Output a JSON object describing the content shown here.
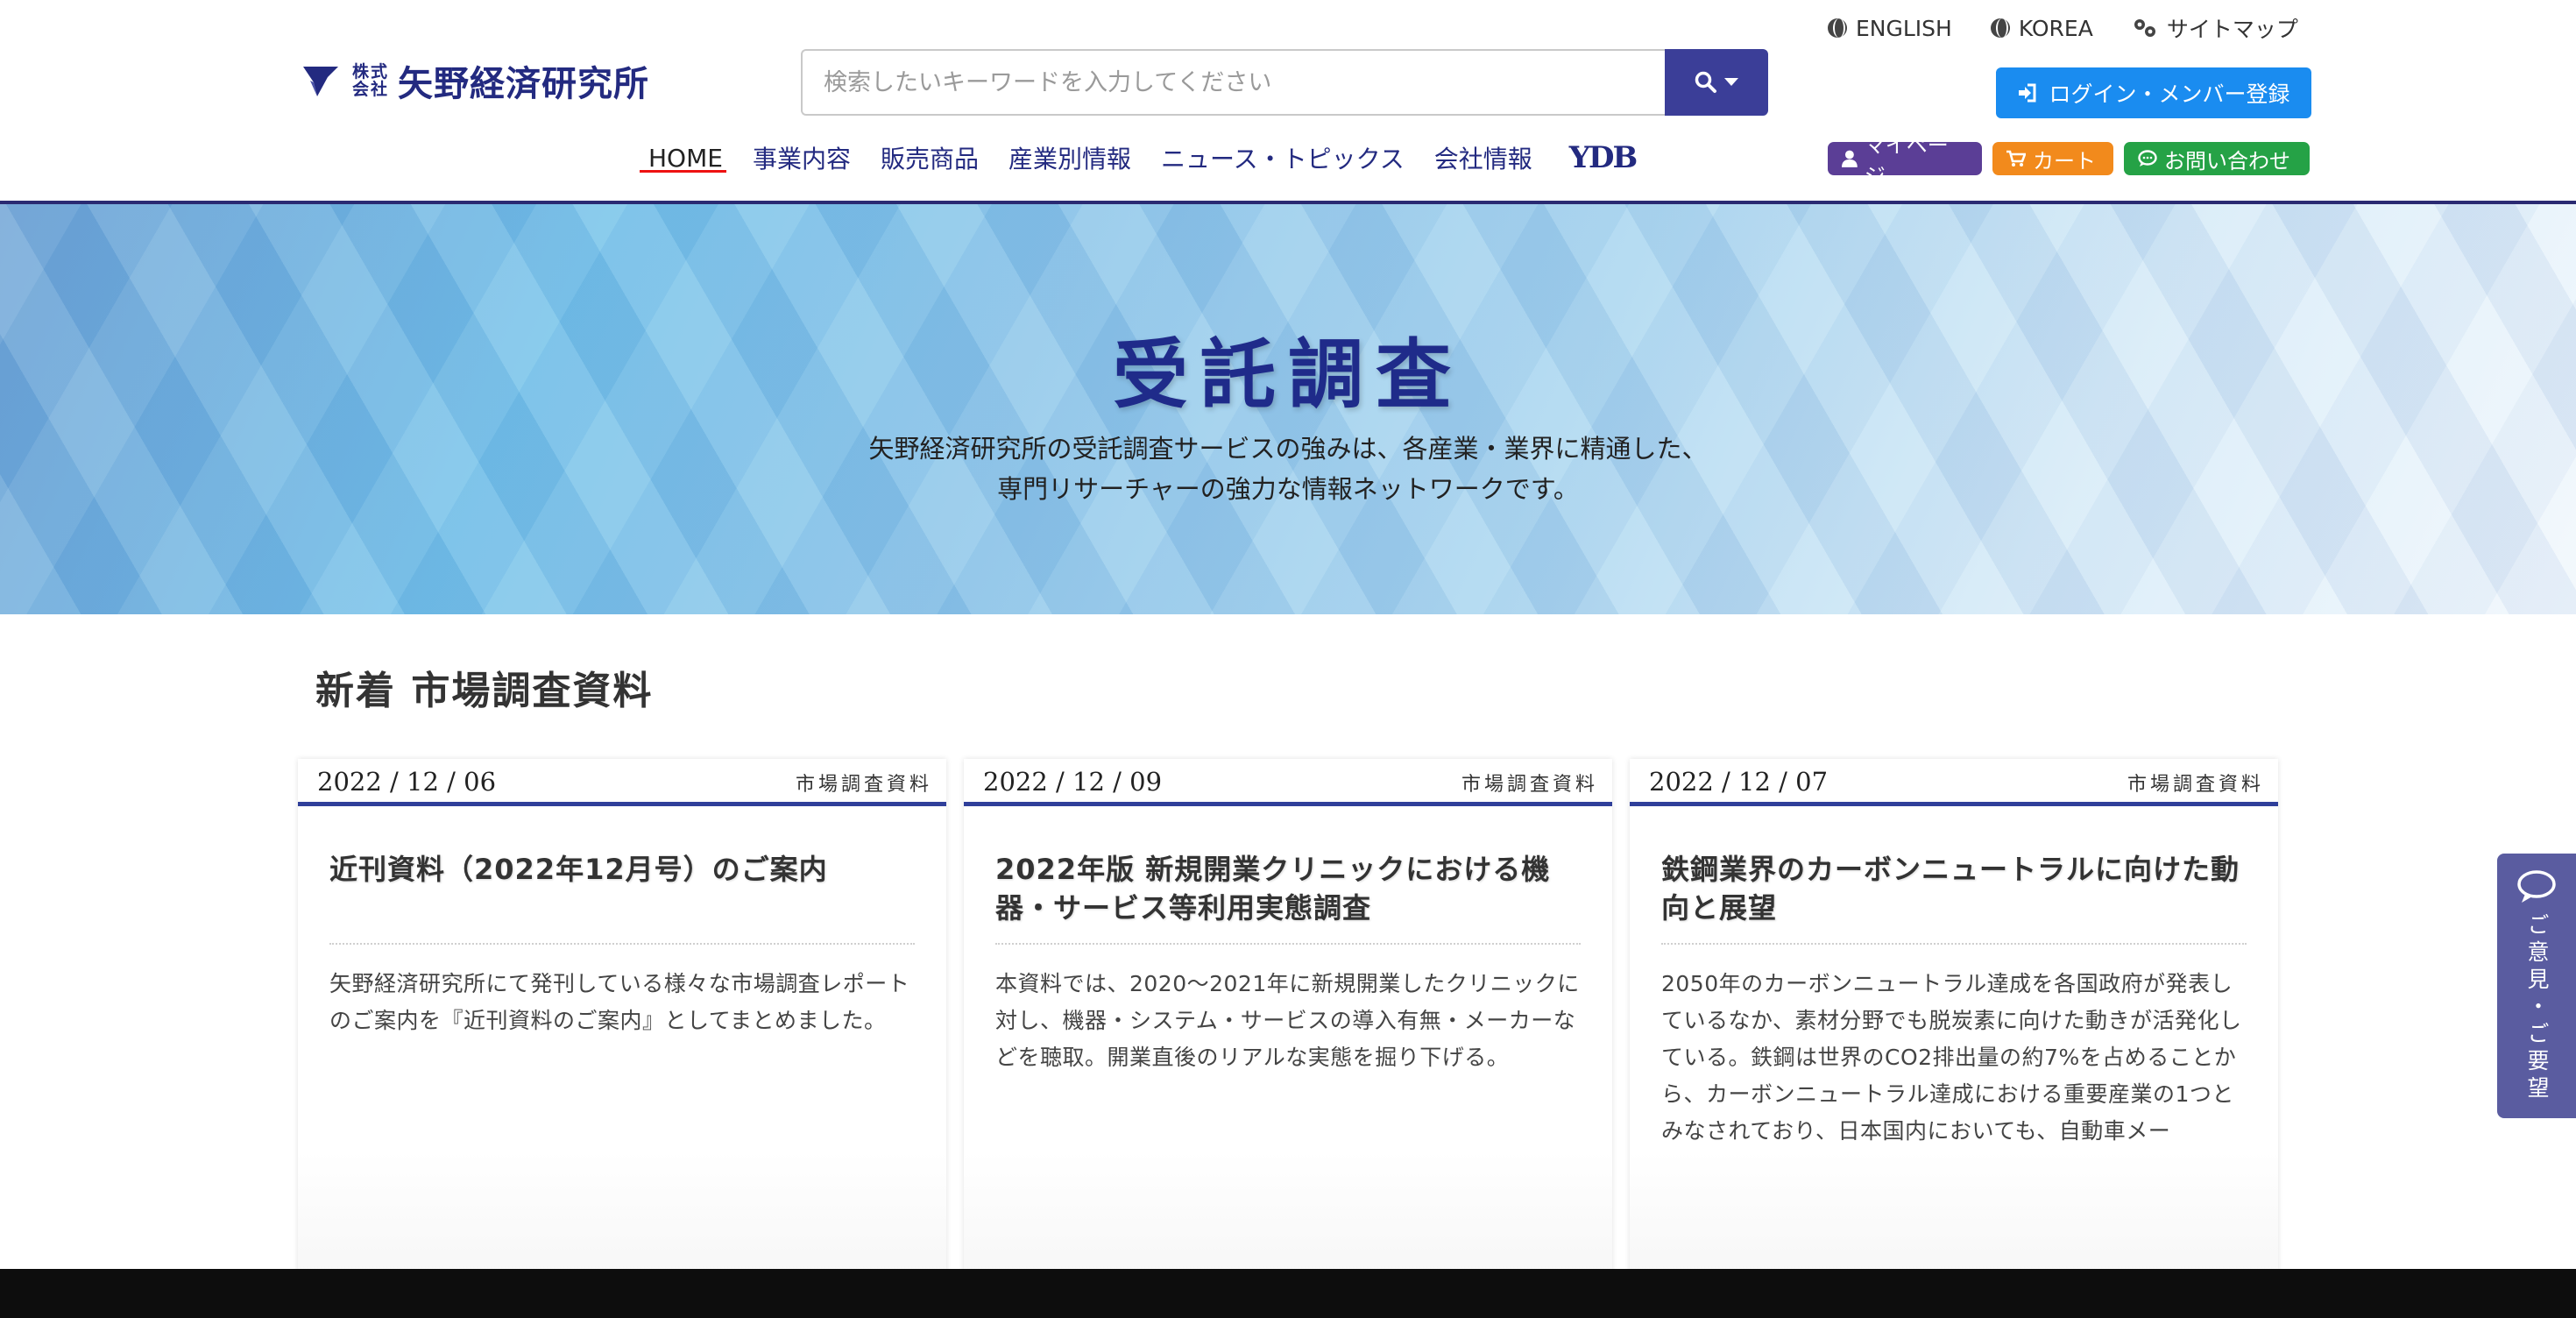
{
  "brand": {
    "kabu_line1": "株式",
    "kabu_line2": "会社",
    "name": "矢野経済研究所"
  },
  "search": {
    "placeholder": "検索したいキーワードを入力してください",
    "button_icon": "search-icon"
  },
  "top_links": [
    {
      "label": "ENGLISH",
      "icon": "globe-icon"
    },
    {
      "label": "KOREA",
      "icon": "globe-icon"
    },
    {
      "label": "サイトマップ",
      "icon": "sitemap-icon"
    }
  ],
  "login_button": "ログイン・メンバー登録",
  "nav": [
    {
      "label": "HOME"
    },
    {
      "label": "事業内容"
    },
    {
      "label": "販売商品"
    },
    {
      "label": "産業別情報"
    },
    {
      "label": "ニュース・トピックス"
    },
    {
      "label": "会社情報"
    },
    {
      "label": "YDB"
    }
  ],
  "pills": {
    "mypage": "マイページ",
    "cart": "カート",
    "contact": "お問い合わせ"
  },
  "hero": {
    "title": "受託調査",
    "desc_line1": "矢野経済研究所の受託調査サービスの強みは、各産業・業界に精通した、",
    "desc_line2": "専門リサーチャーの強力な情報ネットワークです。"
  },
  "section": {
    "title": "新着 市場調査資料"
  },
  "cards": [
    {
      "date": "2022 / 12 / 06",
      "category": "市場調査資料",
      "title": "近刊資料（2022年12月号）のご案内",
      "body": "矢野経済研究所にて発刊している様々な市場調査レポートのご案内を『近刊資料のご案内』としてまとめました。"
    },
    {
      "date": "2022 / 12 / 09",
      "category": "市場調査資料",
      "title": "2022年版 新規開業クリニックにおける機器・サービス等利用実態調査",
      "body": "本資料では、2020〜2021年に新規開業したクリニックに対し、機器・システム・サービスの導入有無・メーカーなどを聴取。開業直後のリアルな実態を掘り下げる。"
    },
    {
      "date": "2022 / 12 / 07",
      "category": "市場調査資料",
      "title": "鉄鋼業界のカーボンニュートラルに向けた動向と展望",
      "body": "2050年のカーボンニュートラル達成を各国政府が発表しているなか、素材分野でも脱炭素に向けた動きが活発化している。鉄鋼は世界のCO2排出量の約7%を占めることから、カーボンニュートラル達成における重要産業の1つとみなされており、日本国内においても、自動車メー"
    }
  ],
  "feedback_tab": "ご意見・ご要望",
  "colors": {
    "brand_navy": "#232a80",
    "search_button": "#3b3e98",
    "login_button": "#1a8cf0",
    "mypage": "#5b3e96",
    "cart": "#f28a1c",
    "contact": "#25a246"
  }
}
